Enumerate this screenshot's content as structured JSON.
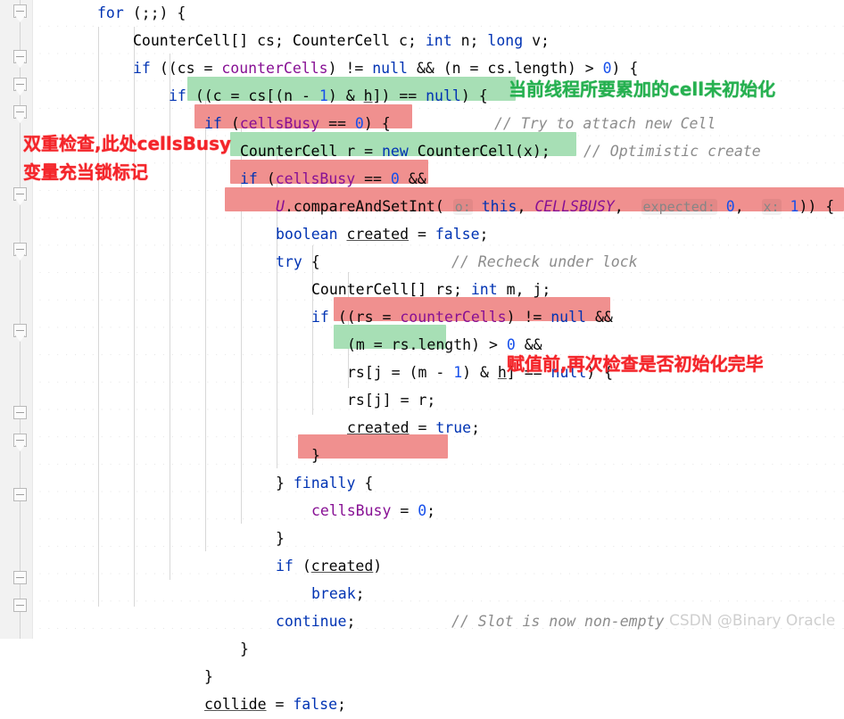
{
  "editor": {
    "language": "java",
    "background": "#ffffff",
    "gutter_background": "#f2f2f2",
    "highlight_red": "#f0908f",
    "highlight_green": "#a7dfb5",
    "annotation_red": "#f4252a",
    "annotation_green": "#26b050"
  },
  "code_lines": [
    {
      "indent": 7,
      "text": "for (;;) {"
    },
    {
      "indent": 11,
      "text": "CounterCell[] cs; CounterCell c; int n; long v;"
    },
    {
      "indent": 11,
      "text": "if ((cs = counterCells) != null && (n = cs.length) > 0) {"
    },
    {
      "indent": 15,
      "text": "if ((c = cs[(n - 1) & h]) == null) {"
    },
    {
      "indent": 19,
      "text": "if (cellsBusy == 0) {"
    },
    {
      "indent": 23,
      "text": "CounterCell r = new CounterCell(x);"
    },
    {
      "indent": 23,
      "text": "if (cellsBusy == 0 &&"
    },
    {
      "indent": 27,
      "text": "U.compareAndSetInt( o: this, CELLSBUSY,  expected: 0,  x: 1)) {"
    },
    {
      "indent": 27,
      "text": "boolean created = false;"
    },
    {
      "indent": 27,
      "text": "try {"
    },
    {
      "indent": 31,
      "text": "CounterCell[] rs; int m, j;"
    },
    {
      "indent": 31,
      "text": "if ((rs = counterCells) != null &&"
    },
    {
      "indent": 35,
      "text": "(m = rs.length) > 0 &&"
    },
    {
      "indent": 35,
      "text": "rs[j = (m - 1) & h] == null) {"
    },
    {
      "indent": 35,
      "text": "rs[j] = r;"
    },
    {
      "indent": 35,
      "text": "created = true;"
    },
    {
      "indent": 31,
      "text": "}"
    },
    {
      "indent": 27,
      "text": "} finally {"
    },
    {
      "indent": 31,
      "text": "cellsBusy = 0;"
    },
    {
      "indent": 27,
      "text": "}"
    },
    {
      "indent": 27,
      "text": "if (created)"
    },
    {
      "indent": 31,
      "text": "break;"
    },
    {
      "indent": 27,
      "text": "continue;"
    },
    {
      "indent": 23,
      "text": "}"
    },
    {
      "indent": 19,
      "text": "}"
    },
    {
      "indent": 19,
      "text": "collide = false;"
    }
  ],
  "comments": [
    {
      "text": "// Try to attach new Cell"
    },
    {
      "text": "// Optimistic create"
    },
    {
      "text": "// Recheck under lock"
    },
    {
      "text": "// Slot is now non-empty"
    }
  ],
  "parameter_hints": [
    {
      "text": "o:"
    },
    {
      "text": "expected:"
    },
    {
      "text": "x:"
    }
  ],
  "annotations": [
    {
      "id": "green-cell-not-init",
      "text": "当前线程所要累加的cell未初始化",
      "color": "#26b050"
    },
    {
      "id": "red-double-check-1",
      "text": "双重检查,此处cellsBusy",
      "color": "#f4252a"
    },
    {
      "id": "red-double-check-2",
      "text": "变量充当锁标记",
      "color": "#f4252a"
    },
    {
      "id": "red-recheck-before-assign",
      "text": "赋值前,再次检查是否初始化完毕",
      "color": "#f4252a"
    }
  ],
  "watermark": {
    "text": "CSDN @Binary Oracle"
  }
}
